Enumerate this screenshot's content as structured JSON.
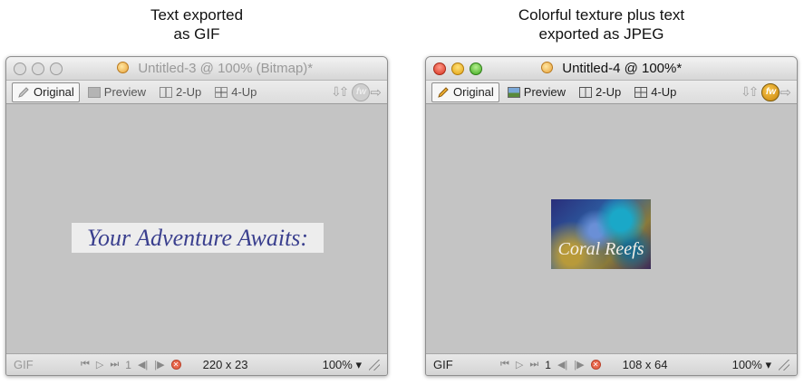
{
  "captions": {
    "left": [
      "Text exported",
      "as GIF"
    ],
    "right": [
      "Colorful texture plus text",
      "exported as JPEG"
    ]
  },
  "windows": [
    {
      "title": "Untitled-3 @ 100% (Bitmap)*",
      "tabs": [
        "Original",
        "Preview",
        "2-Up",
        "4-Up"
      ],
      "image_text": "Your Adventure Awaits:",
      "status": {
        "format": "GIF",
        "frame": "1",
        "size": "220 x 23",
        "zoom": "100%"
      }
    },
    {
      "title": "Untitled-4 @ 100%*",
      "tabs": [
        "Original",
        "Preview",
        "2-Up",
        "4-Up"
      ],
      "image_text": "Coral Reefs",
      "status": {
        "format": "GIF",
        "frame": "1",
        "size": "108 x 64",
        "zoom": "100%"
      }
    }
  ],
  "icons": {
    "fireworks_logo": "fw",
    "zoom_arrow": "▾"
  },
  "colors": {
    "traffic_red": "#d8321f",
    "traffic_yellow": "#e2a410",
    "traffic_green": "#3ea91f",
    "gif_text": "#3a3f8e",
    "canvas": "#c4c4c4"
  }
}
